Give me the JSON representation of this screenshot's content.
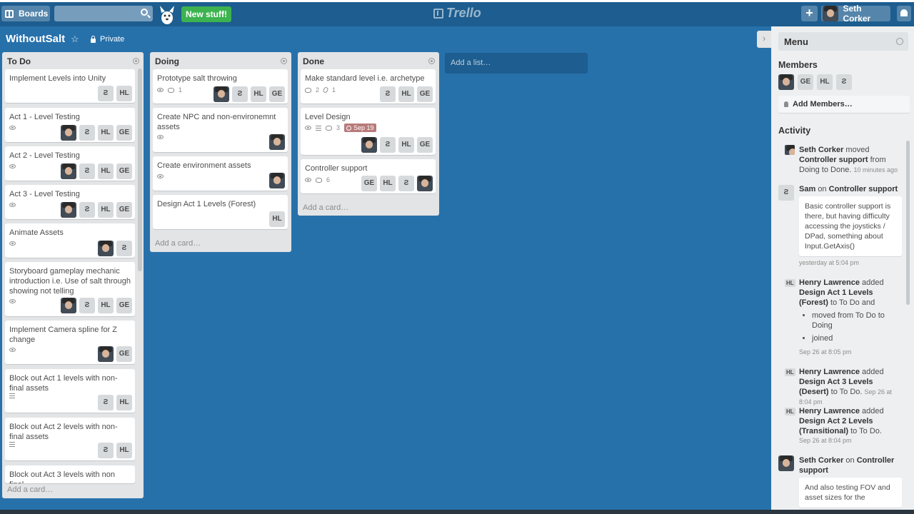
{
  "header": {
    "boards_label": "Boards",
    "search_placeholder": "",
    "new_stuff_label": "New stuff!",
    "logo_text": "Trello",
    "add_label": "+",
    "user_name": "Seth Corker"
  },
  "board": {
    "title": "WithoutSalt",
    "visibility": "Private"
  },
  "lists": [
    {
      "title": "To Do",
      "add_card": "Add a card…",
      "cards": [
        {
          "title": "Implement Levels into Unity",
          "members": [
            "Ƨ",
            "HL"
          ]
        },
        {
          "title": "Act 1 - Level Testing",
          "members": [
            "avatar",
            "Ƨ",
            "HL",
            "GE"
          ]
        },
        {
          "title": "Act 2 - Level Testing",
          "members": [
            "avatar",
            "Ƨ",
            "HL",
            "GE"
          ]
        },
        {
          "title": "Act 3 - Level Testing",
          "members": [
            "avatar",
            "Ƨ",
            "HL",
            "GE"
          ]
        },
        {
          "title": "Animate Assets",
          "members": [
            "avatar",
            "Ƨ"
          ]
        },
        {
          "title": "Storyboard gameplay mechanic introduction i.e. Use of salt through showing not telling",
          "members": [
            "avatar",
            "Ƨ",
            "HL",
            "GE"
          ]
        },
        {
          "title": "Implement Camera spline for Z change",
          "members": [
            "avatar",
            "GE"
          ]
        },
        {
          "title": "Block out Act 1 levels with non-final assets",
          "members": [
            "Ƨ",
            "HL"
          ]
        },
        {
          "title": "Block out Act 2 levels with non-final assets",
          "members": [
            "Ƨ",
            "HL"
          ]
        },
        {
          "title": "Block out Act 3 levels with non final",
          "members": []
        }
      ]
    },
    {
      "title": "Doing",
      "add_card": "Add a card…",
      "cards": [
        {
          "title": "Prototype salt throwing",
          "comments": "1",
          "members": [
            "avatar",
            "Ƨ",
            "HL",
            "GE"
          ]
        },
        {
          "title": "Create NPC and non-environemnt assets",
          "members": [
            "avatar"
          ]
        },
        {
          "title": "Create environment assets",
          "members": [
            "avatar"
          ]
        },
        {
          "title": "Design Act 1 Levels (Forest)",
          "members": [
            "HL"
          ]
        }
      ]
    },
    {
      "title": "Done",
      "add_card": "Add a card…",
      "cards": [
        {
          "title": "Make standard level i.e. archetype",
          "comments": "2",
          "attachments": "1",
          "members": [
            "Ƨ",
            "HL",
            "GE"
          ]
        },
        {
          "title": "Level Design",
          "comments": "3",
          "due": "Sep 19",
          "members": [
            "avatar",
            "Ƨ",
            "HL",
            "GE"
          ]
        },
        {
          "title": "Controller support",
          "comments": "6",
          "members": [
            "GE",
            "HL",
            "Ƨ",
            "avatar"
          ]
        }
      ]
    }
  ],
  "add_list_label": "Add a list…",
  "sidebar": {
    "menu_title": "Menu",
    "members_title": "Members",
    "members": [
      "avatar",
      "GE",
      "HL",
      "Ƨ"
    ],
    "add_members_label": "Add Members…",
    "activity_title": "Activity",
    "activity": [
      {
        "user": "Seth Corker",
        "action": "moved",
        "target": "Controller support",
        "rest": "from Doing to Done.",
        "time": "10 minutes ago"
      },
      {
        "user": "Sam",
        "action": "on",
        "target": "Controller support",
        "comment": "Basic controller support is there, but having difficulty accessing the joysticks / DPad, something about Input.GetAxis()",
        "time": "yesterday at 5:04 pm"
      },
      {
        "user": "Henry Lawrence",
        "action": "added",
        "target": "Design Act 1 Levels (Forest)",
        "rest": "to To Do and",
        "bullets": [
          "moved from To Do to Doing",
          "joined"
        ],
        "time": "Sep 26 at 8:05 pm"
      },
      {
        "user": "Henry Lawrence",
        "action": "added",
        "target": "Design Act 3 Levels (Desert)",
        "rest": "to To Do.",
        "time": "Sep 26 at 8:04 pm"
      },
      {
        "user": "Henry Lawrence",
        "action": "added",
        "target": "Design Act 2 Levels (Transitional)",
        "rest": "to To Do.",
        "time": "Sep 26 at 8:04 pm"
      },
      {
        "user": "Seth Corker",
        "action": "on",
        "target": "Controller support",
        "comment": "And also testing FOV and asset sizes for the"
      }
    ]
  }
}
